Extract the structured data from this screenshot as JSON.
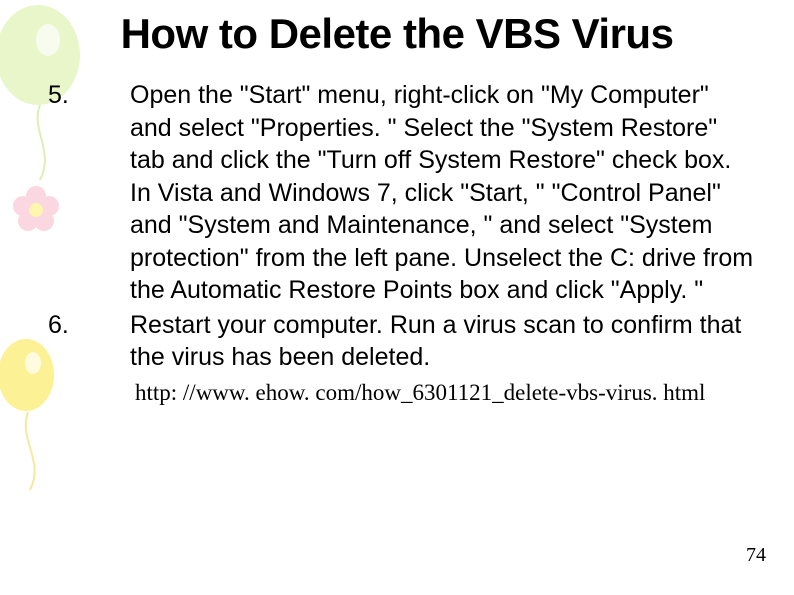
{
  "title": "How to Delete the VBS Virus",
  "steps": [
    {
      "num": "5.",
      "text": "Open the \"Start\" menu, right-click on \"My Computer\" and select \"Properties. \" Select the \"System Restore\" tab and click the \"Turn off System Restore\" check box. In Vista and Windows 7, click \"Start, \" \"Control Panel\" and \"System and Maintenance, \" and select \"System protection\" from the left pane. Unselect the C: drive from the Automatic Restore Points box and click \"Apply. \""
    },
    {
      "num": "6.",
      "text": "Restart your computer. Run a virus scan to confirm that the virus has been deleted."
    }
  ],
  "source_url": "http: //www. ehow. com/how_6301121_delete-vbs-virus. html",
  "page_number": "74"
}
